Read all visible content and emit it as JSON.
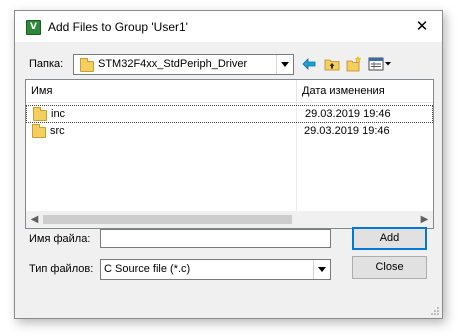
{
  "window": {
    "title": "Add Files to Group 'User1'",
    "close_glyph": "✕",
    "app_icon_text": "V"
  },
  "lookin": {
    "label": "Папка:",
    "value": "STM32F4xx_StdPeriph_Driver"
  },
  "toolbar": {
    "icons": [
      "back-arrow-icon",
      "up-folder-icon",
      "new-folder-icon",
      "view-menu-icon"
    ]
  },
  "filelist": {
    "columns": [
      "Имя",
      "Дата изменения"
    ],
    "sort_glyph": "˄",
    "rows": [
      {
        "name": "inc",
        "date": "29.03.2019 19:46"
      },
      {
        "name": "src",
        "date": "29.03.2019 19:46"
      }
    ]
  },
  "filename": {
    "label": "Имя файла:",
    "value": ""
  },
  "filetype": {
    "label": "Тип файлов:",
    "value": "C Source file (*.c)"
  },
  "buttons": {
    "add": "Add",
    "close": "Close"
  },
  "colors": {
    "accent": "#0078d7",
    "folder": "#f4cf5f",
    "back_arrow": "#1ea0d6"
  }
}
